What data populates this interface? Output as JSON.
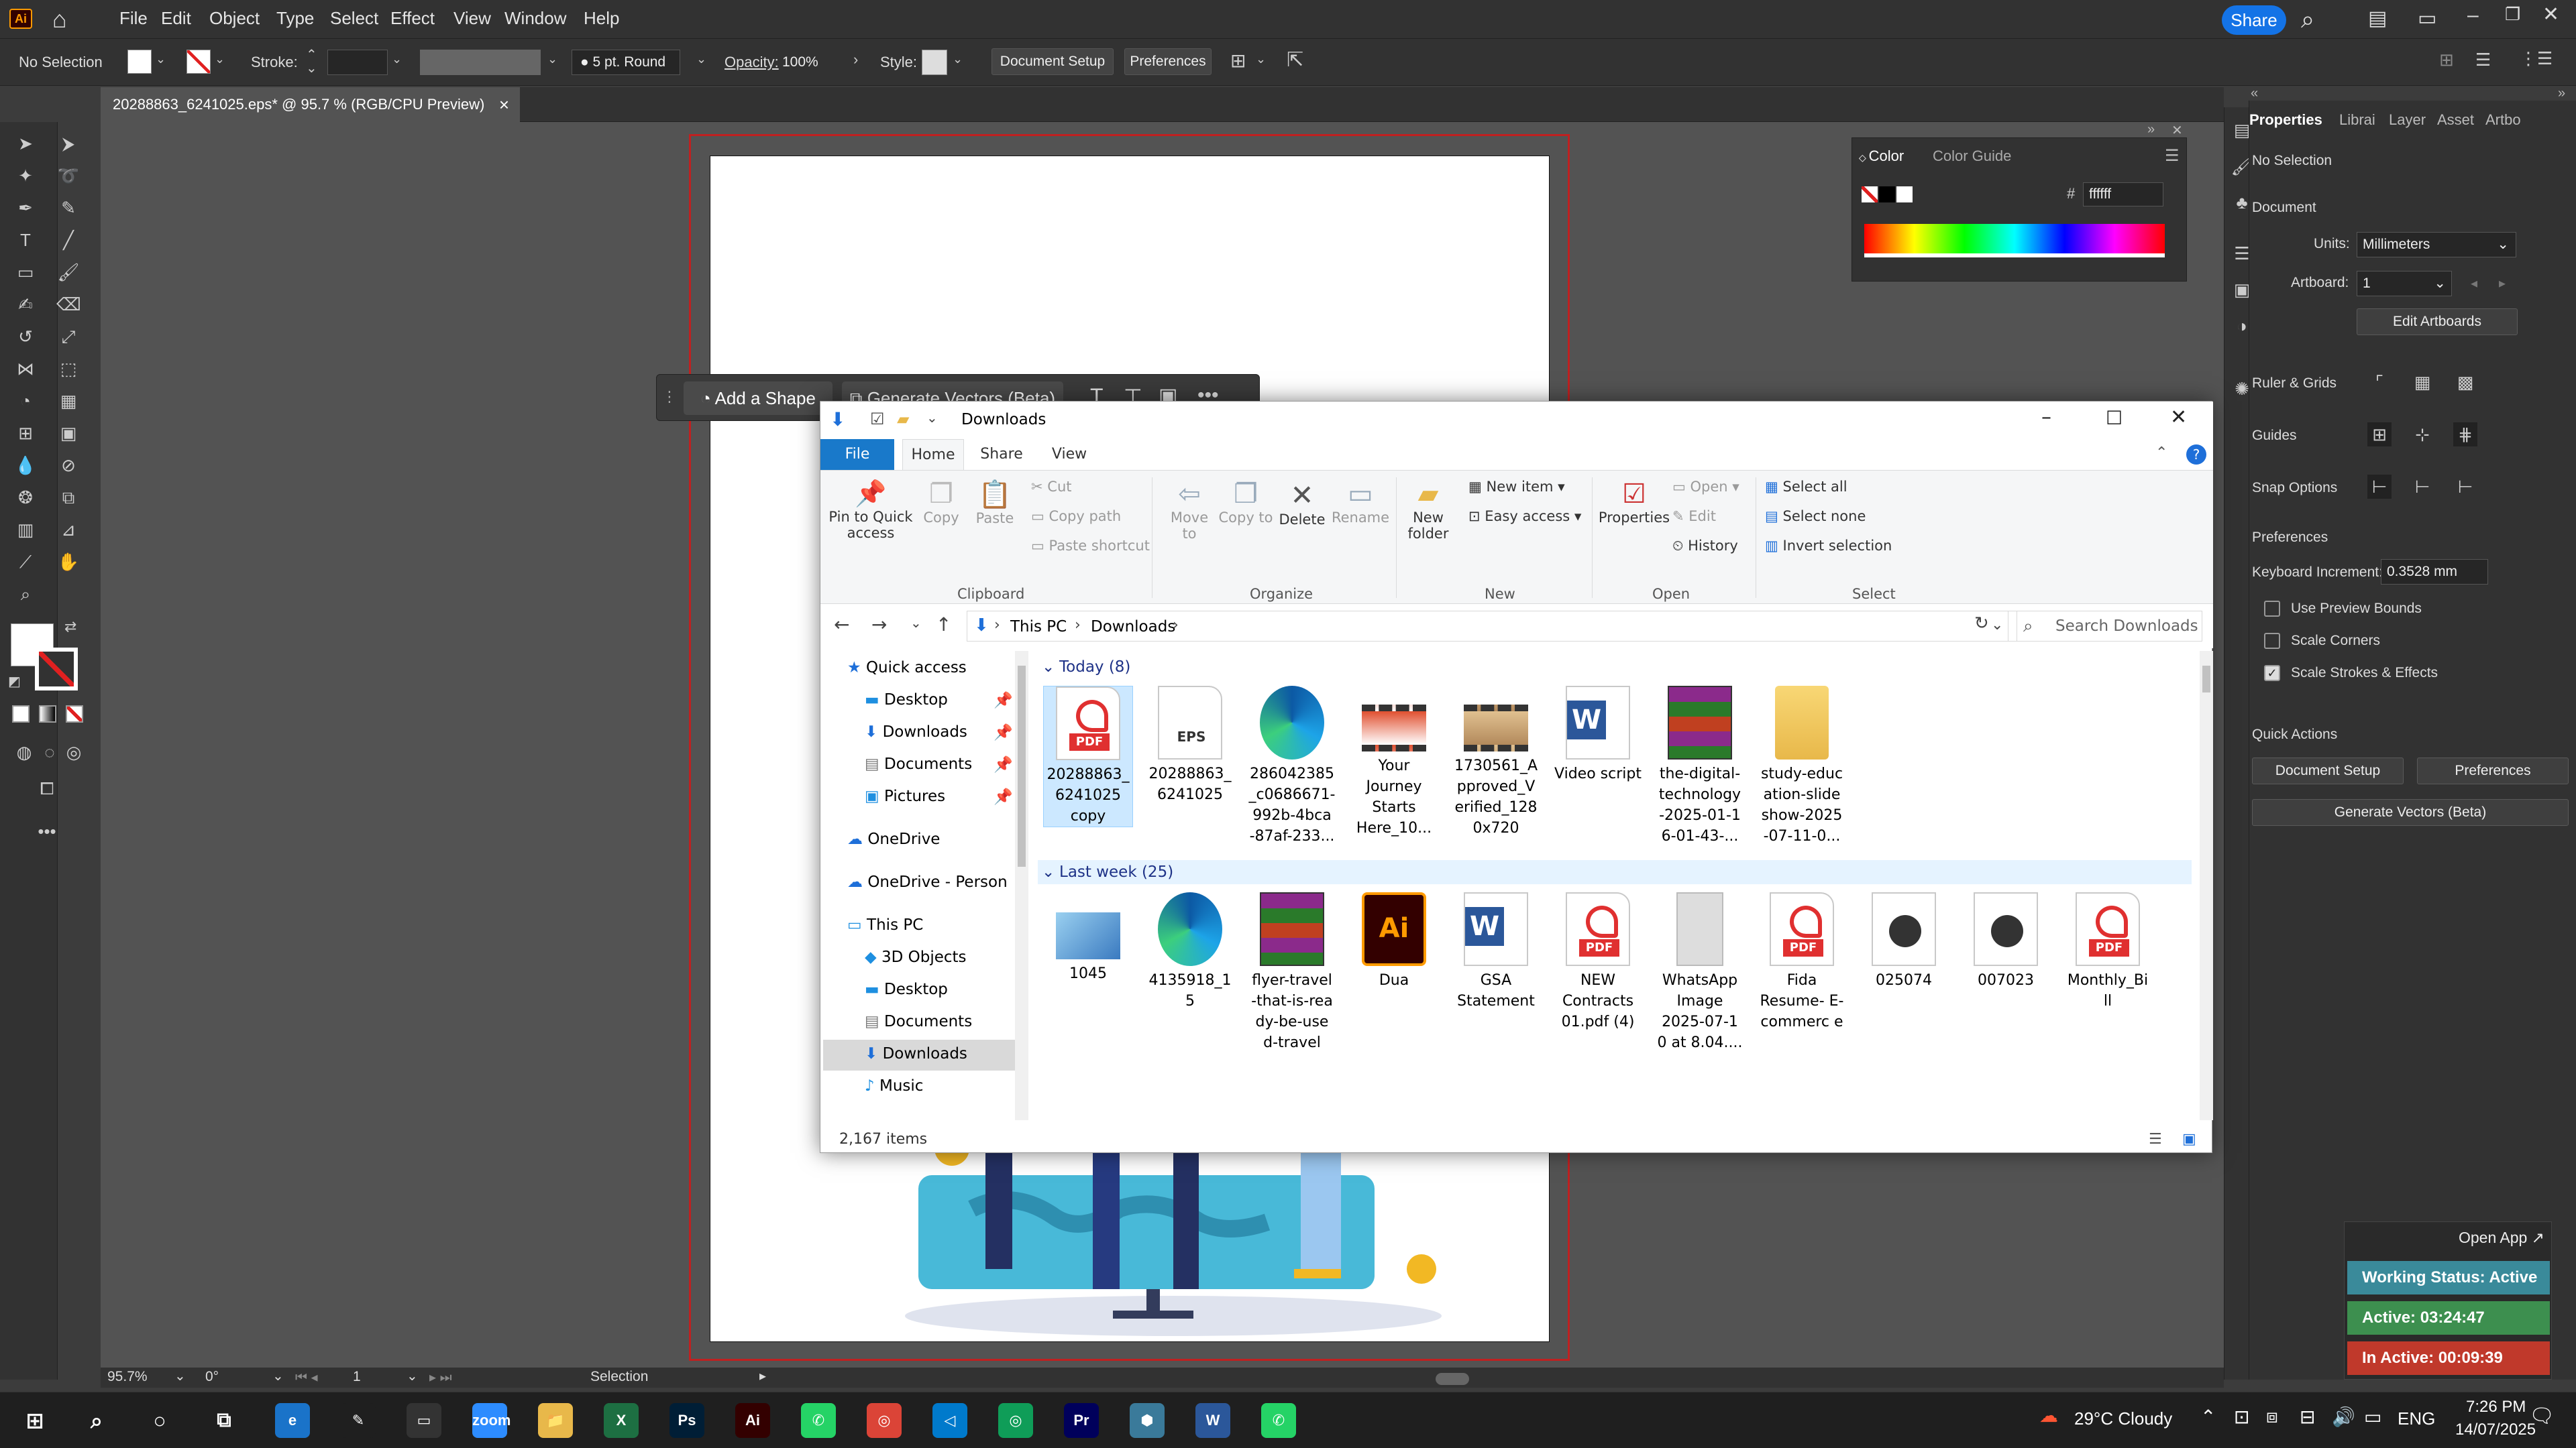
{
  "menu": {
    "items": [
      "File",
      "Edit",
      "Object",
      "Type",
      "Select",
      "Effect",
      "View",
      "Window",
      "Help"
    ],
    "share": "Share",
    "logo": "Ai"
  },
  "control": {
    "selection": "No Selection",
    "stroke_label": "Stroke:",
    "brush": "5 pt. Round",
    "opacity_label": "Opacity:",
    "opacity_value": "100%",
    "style_label": "Style:",
    "document_setup": "Document Setup",
    "preferences": "Preferences"
  },
  "doc_tab": {
    "title": "20288863_6241025.eps* @ 95.7 % (RGB/CPU Preview)",
    "close": "×"
  },
  "context_bar": {
    "add_shape": "Add a Shape",
    "generate_vectors": "Generate Vectors (Beta)"
  },
  "color_panel": {
    "tab_color": "Color",
    "tab_guide": "Color Guide",
    "hex_prefix": "#",
    "hex": "ffffff"
  },
  "props": {
    "tabs": [
      "Properties",
      "Librai",
      "Layer",
      "Asset",
      "Artbo"
    ],
    "no_selection": "No Selection",
    "document": "Document",
    "units_label": "Units:",
    "units_value": "Millimeters",
    "artboard_label": "Artboard:",
    "artboard_value": "1",
    "edit_artboards": "Edit Artboards",
    "ruler_grids": "Ruler & Grids",
    "guides": "Guides",
    "snap_options": "Snap Options",
    "preferences": "Preferences",
    "keyboard_increment_label": "Keyboard Increment:",
    "keyboard_increment_value": "0.3528 mm",
    "use_preview_bounds": "Use Preview Bounds",
    "scale_corners": "Scale Corners",
    "scale_strokes": "Scale Strokes & Effects",
    "quick_actions": "Quick Actions",
    "document_setup": "Document Setup",
    "preferences_btn": "Preferences",
    "generate_vectors": "Generate Vectors (Beta)"
  },
  "status": {
    "zoom": "95.7%",
    "rotation": "0°",
    "artboard": "1",
    "tool": "Selection"
  },
  "explorer": {
    "title": "Downloads",
    "tabs": [
      "File",
      "Home",
      "Share",
      "View"
    ],
    "ribbon": {
      "pin": "Pin to Quick access",
      "copy": "Copy",
      "paste": "Paste",
      "cut": "Cut",
      "copy_path": "Copy path",
      "paste_shortcut": "Paste shortcut",
      "move_to": "Move to",
      "copy_to": "Copy to",
      "delete": "Delete",
      "rename": "Rename",
      "new_folder": "New folder",
      "new_item": "New item",
      "easy_access": "Easy access",
      "properties": "Properties",
      "open": "Open",
      "edit": "Edit",
      "history": "History",
      "select_all": "Select all",
      "select_none": "Select none",
      "invert_selection": "Invert selection",
      "groups": [
        "Clipboard",
        "Organize",
        "New",
        "Open",
        "Select"
      ]
    },
    "address": {
      "this_pc": "This PC",
      "downloads": "Downloads"
    },
    "search_placeholder": "Search Downloads",
    "nav": {
      "quick_access": "Quick access",
      "qa_items": [
        "Desktop",
        "Downloads",
        "Documents",
        "Pictures"
      ],
      "onedrive": "OneDrive",
      "onedrive_personal": "OneDrive - Person",
      "this_pc": "This PC",
      "pc_items": [
        "3D Objects",
        "Desktop",
        "Documents",
        "Downloads",
        "Music"
      ]
    },
    "today_header": "Today (8)",
    "today": [
      {
        "name": "20288863_ 6241025 copy",
        "icon": "pdf"
      },
      {
        "name": "20288863_ 6241025",
        "icon": "eps"
      },
      {
        "name": "286042385 _c0686671- 992b-4bca -87af-233...",
        "icon": "edge"
      },
      {
        "name": "Your Journey Starts Here_10...",
        "icon": "vid2"
      },
      {
        "name": "1730561_A pproved_V erified_128 0x720",
        "icon": "vid"
      },
      {
        "name": "Video script",
        "icon": "word"
      },
      {
        "name": "the-digital- technology -2025-01-1 6-01-43-...",
        "icon": "rar"
      },
      {
        "name": "study-educ ation-slide show-2025 -07-11-0...",
        "icon": "folder"
      }
    ],
    "lastweek_header": "Last week (25)",
    "lastweek": [
      {
        "name": "1045",
        "icon": "img"
      },
      {
        "name": "4135918_1 5",
        "icon": "edge"
      },
      {
        "name": "flyer-travel -that-is-rea dy-be-use d-travel",
        "icon": "rar"
      },
      {
        "name": "Dua",
        "icon": "ai"
      },
      {
        "name": "GSA Statement",
        "icon": "word"
      },
      {
        "name": "NEW Contracts 01.pdf (4)",
        "icon": "pdf"
      },
      {
        "name": "WhatsApp Image 2025-07-1 0 at 8.04....",
        "icon": "wa"
      },
      {
        "name": "Fida Resume- E-commerc e",
        "icon": "pdf"
      },
      {
        "name": "025074",
        "icon": "media"
      },
      {
        "name": "007023",
        "icon": "media"
      },
      {
        "name": "Monthly_Bi ll",
        "icon": "pdf"
      }
    ],
    "items_count": "2,167 items"
  },
  "work_status": {
    "open_app": "Open App ↗",
    "working": "Working Status: Active",
    "active": "Active: 03:24:47",
    "inactive": "In Active: 00:09:39",
    "colors": {
      "working": "#3a8a9a",
      "active": "#3d8f4f",
      "inactive": "#c0392b"
    }
  },
  "taskbar": {
    "weather": "29°C Cloudy",
    "lang": "ENG",
    "time": "7:26 PM",
    "date": "14/07/2025",
    "apps": [
      {
        "name": "edge-icon",
        "label": "e",
        "color": "#1a73c9"
      },
      {
        "name": "pen-icon",
        "label": "✎",
        "color": "#1f1f1f"
      },
      {
        "name": "terminal-icon",
        "label": "▭",
        "color": "#333"
      },
      {
        "name": "zoom-icon",
        "label": "zoom",
        "color": "#2d8cff"
      },
      {
        "name": "file-explorer-icon",
        "label": "📁",
        "color": "#e8b84a"
      },
      {
        "name": "excel-icon",
        "label": "X",
        "color": "#1d6f42"
      },
      {
        "name": "photoshop-icon",
        "label": "Ps",
        "color": "#001e36"
      },
      {
        "name": "illustrator-icon",
        "label": "Ai",
        "color": "#330000"
      },
      {
        "name": "phone-link-icon",
        "label": "✆",
        "color": "#25d366"
      },
      {
        "name": "chrome-icon",
        "label": "◎",
        "color": "#db4437"
      },
      {
        "name": "vscode-icon",
        "label": "◁",
        "color": "#007acc"
      },
      {
        "name": "chrome-profile-icon",
        "label": "◎",
        "color": "#0f9d58"
      },
      {
        "name": "premiere-icon",
        "label": "Pr",
        "color": "#00005b"
      },
      {
        "name": "app-icon",
        "label": "⬢",
        "color": "#3a7a9a"
      },
      {
        "name": "word-icon",
        "label": "W",
        "color": "#2b579a"
      },
      {
        "name": "whatsapp-icon",
        "label": "✆",
        "color": "#25d366"
      }
    ]
  }
}
